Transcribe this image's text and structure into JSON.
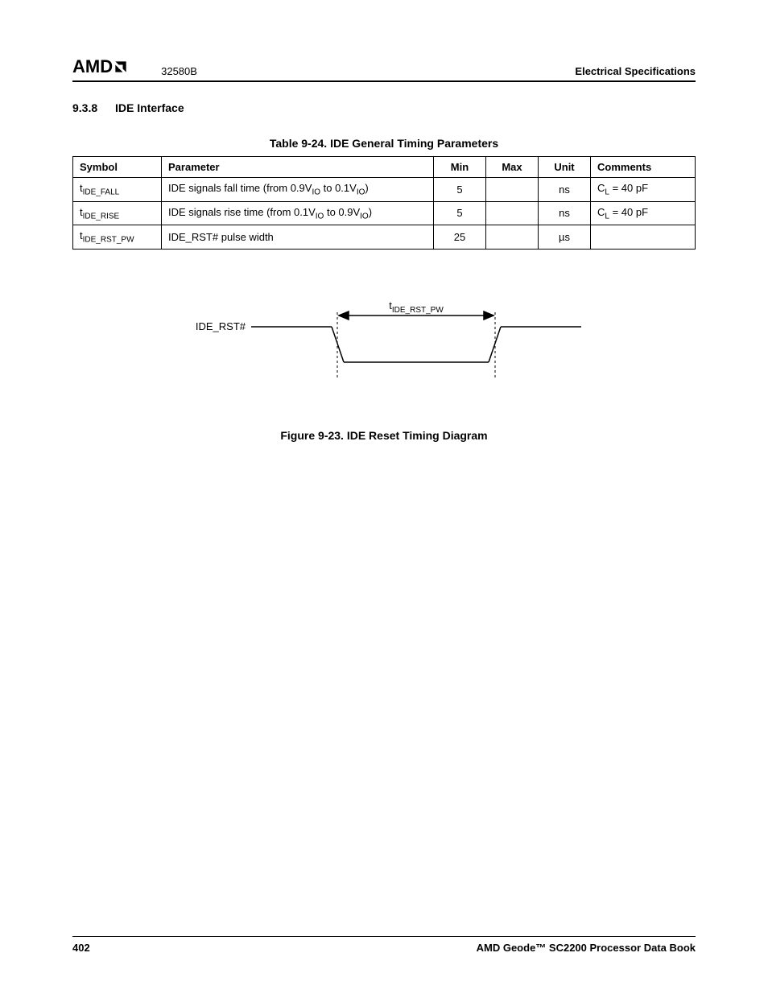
{
  "header": {
    "logo_text": "AMD",
    "doc_number": "32580B",
    "section_title": "Electrical Specifications"
  },
  "section": {
    "number": "9.3.8",
    "title": "IDE Interface"
  },
  "table": {
    "caption": "Table 9-24.  IDE General Timing Parameters",
    "headers": {
      "symbol": "Symbol",
      "parameter": "Parameter",
      "min": "Min",
      "max": "Max",
      "unit": "Unit",
      "comments": "Comments"
    },
    "rows": [
      {
        "symbol_prefix": "t",
        "symbol_sub": "IDE_FALL",
        "param_pre": "IDE signals fall time (from 0.9V",
        "param_sub1": "IO",
        "param_mid": " to 0.1V",
        "param_sub2": "IO",
        "param_post": ")",
        "min": "5",
        "max": "",
        "unit": "ns",
        "comment_pre": "C",
        "comment_sub": "L",
        "comment_post": " = 40 pF"
      },
      {
        "symbol_prefix": "t",
        "symbol_sub": "IDE_RISE",
        "param_pre": "IDE signals rise time (from 0.1V",
        "param_sub1": "IO",
        "param_mid": " to 0.9V",
        "param_sub2": "IO",
        "param_post": ")",
        "min": "5",
        "max": "",
        "unit": "ns",
        "comment_pre": "C",
        "comment_sub": "L",
        "comment_post": " = 40 pF"
      },
      {
        "symbol_prefix": "t",
        "symbol_sub": "IDE_RST_PW",
        "param_pre": "IDE_RST# pulse width",
        "param_sub1": "",
        "param_mid": "",
        "param_sub2": "",
        "param_post": "",
        "min": "25",
        "max": "",
        "unit": "µs",
        "comment_pre": "",
        "comment_sub": "",
        "comment_post": ""
      }
    ]
  },
  "figure": {
    "signal_name": "IDE_RST#",
    "arrow_label_prefix": "t",
    "arrow_label_sub": "IDE_RST_PW",
    "caption": "Figure 9-23.  IDE Reset Timing Diagram"
  },
  "footer": {
    "page_number": "402",
    "book_title": "AMD Geode™ SC2200  Processor Data Book"
  }
}
